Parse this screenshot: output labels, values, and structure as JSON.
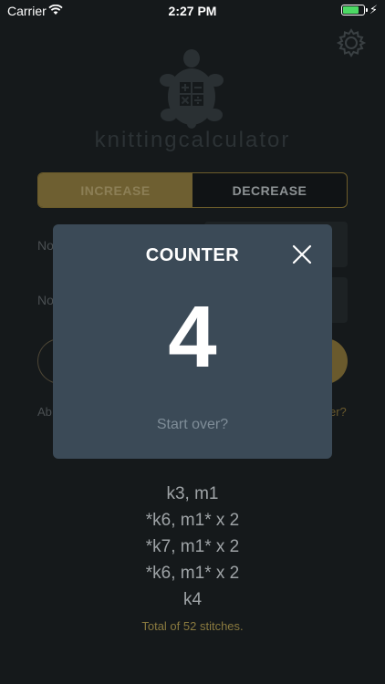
{
  "status_bar": {
    "carrier": "Carrier",
    "time": "2:27 PM",
    "battery_color": "#4cd964"
  },
  "header": {
    "settings_icon": "gear-icon",
    "logo_icon": "turtle-calculator-icon",
    "app_name": "knittingcalculator"
  },
  "mode_toggle": {
    "increase_label": "INCREASE",
    "decrease_label": "DECREASE",
    "selected": "INCREASE"
  },
  "background_form": {
    "label_1": "No",
    "label_2": "No",
    "left_hint": "Ab",
    "right_hint": "er?"
  },
  "counter_modal": {
    "title": "COUNTER",
    "count": "4",
    "start_over": "Start over?",
    "close_icon": "close-icon"
  },
  "results": {
    "lines": [
      "k3, m1",
      "*k6, m1* x 2",
      "*k7, m1* x 2",
      "*k6, m1* x 2",
      "k4"
    ],
    "total": "Total of 52 stitches."
  },
  "colors": {
    "background": "#15191b",
    "accent": "#6e5f31",
    "modal": "#3b4a57"
  }
}
